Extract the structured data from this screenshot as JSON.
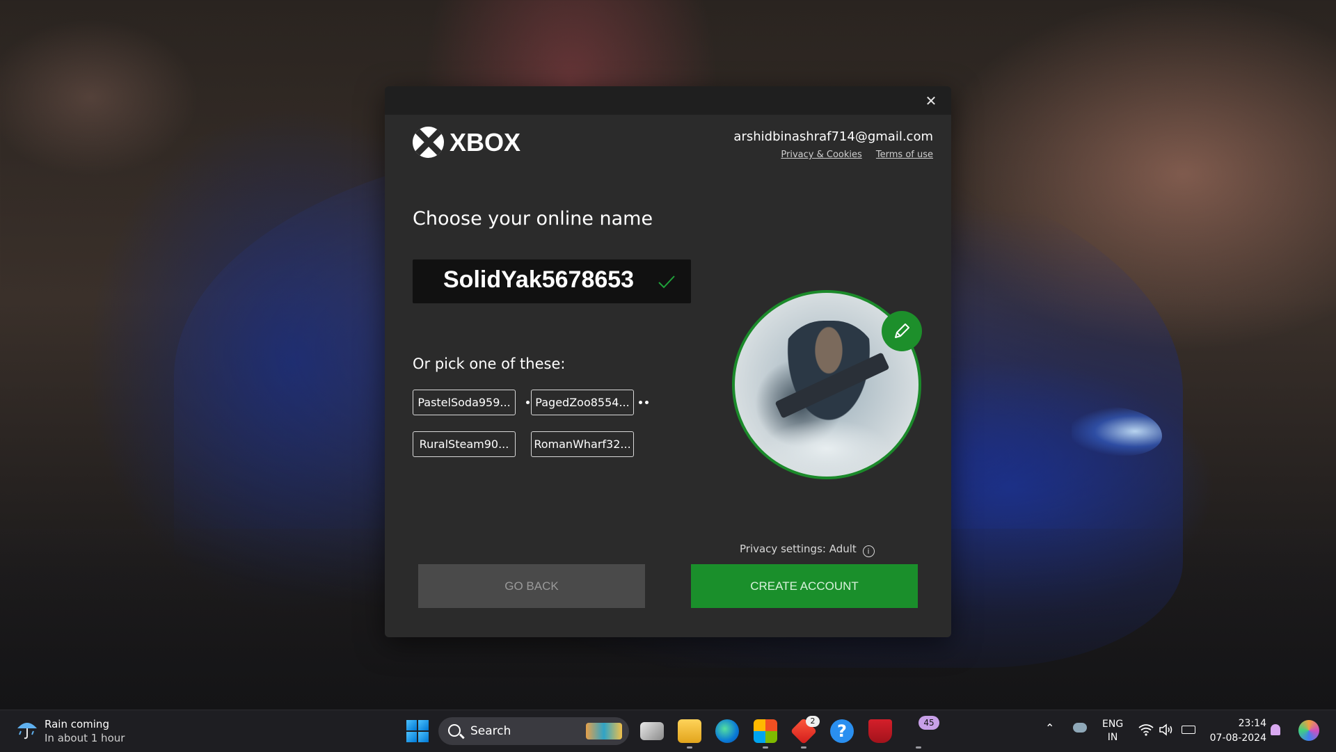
{
  "dialog": {
    "brand": "XBOX",
    "account_email": "arshidbinashraf714@gmail.com",
    "links": {
      "privacy": "Privacy & Cookies",
      "terms": "Terms of use"
    },
    "heading": "Choose your online name",
    "gamertag": "SolidYak5678653",
    "pick_label": "Or pick one of these:",
    "suggestions": [
      "PastelSoda959...",
      "PagedZoo8554...",
      "RuralSteam90...",
      "RomanWharf32..."
    ],
    "privacy_settings": "Privacy settings: Adult",
    "buttons": {
      "back": "GO BACK",
      "create": "CREATE ACCOUNT"
    },
    "colors": {
      "accent": "#1a8f2b",
      "panel": "#2b2b2b",
      "titlebar": "#1f1f1f"
    }
  },
  "taskbar": {
    "weather": {
      "title": "Rain coming",
      "subtitle": "In about 1 hour"
    },
    "search_label": "Search",
    "badges": {
      "office": "2",
      "pill": "45"
    },
    "language": {
      "lang": "ENG",
      "region": "IN"
    },
    "clock": {
      "time": "23:14",
      "date": "07-08-2024"
    }
  }
}
